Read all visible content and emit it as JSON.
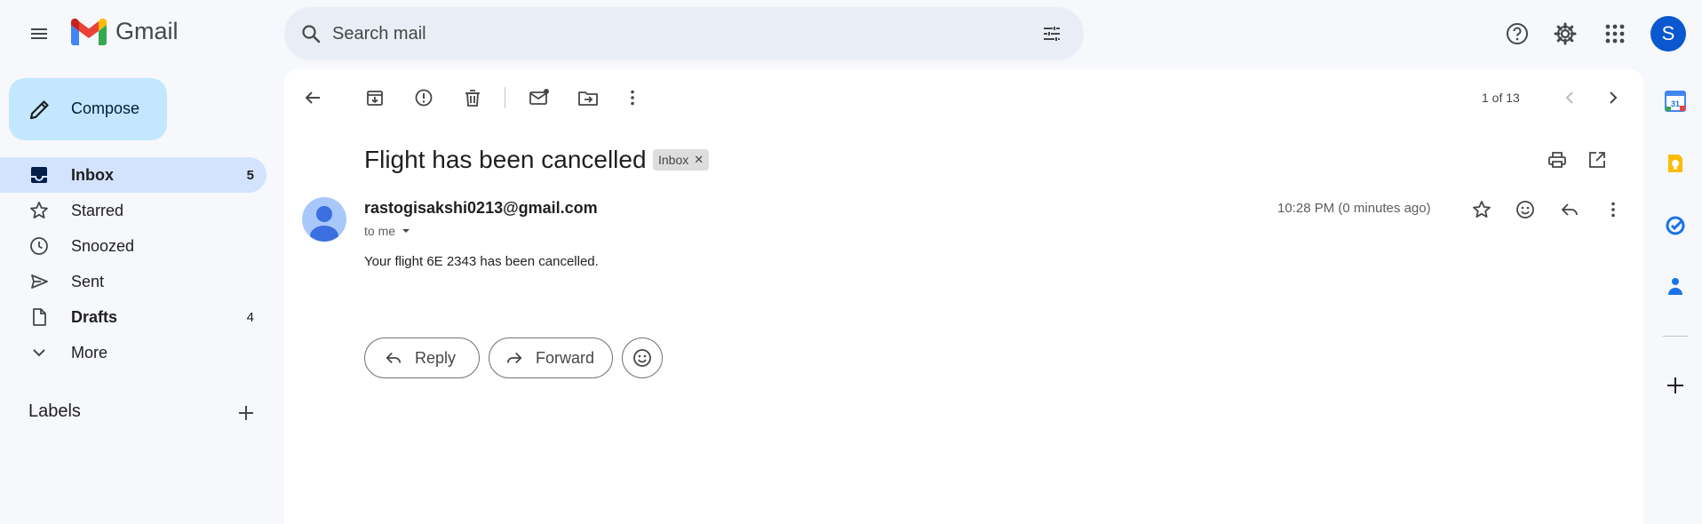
{
  "app": {
    "name": "Gmail"
  },
  "search": {
    "placeholder": "Search mail"
  },
  "user": {
    "avatar_initial": "S"
  },
  "compose": {
    "label": "Compose"
  },
  "sidebar": {
    "items": [
      {
        "label": "Inbox",
        "count": "5",
        "icon": "inbox-icon",
        "active": true
      },
      {
        "label": "Starred",
        "count": "",
        "icon": "star-icon",
        "active": false
      },
      {
        "label": "Snoozed",
        "count": "",
        "icon": "clock-icon",
        "active": false
      },
      {
        "label": "Sent",
        "count": "",
        "icon": "send-icon",
        "active": false
      },
      {
        "label": "Drafts",
        "count": "4",
        "icon": "draft-icon",
        "active": false
      },
      {
        "label": "More",
        "count": "",
        "icon": "chevron-down-icon",
        "active": false
      }
    ],
    "labels_heading": "Labels"
  },
  "toolbar": {
    "pager": "1 of 13"
  },
  "message": {
    "subject": "Flight has been cancelled",
    "label_chip": "Inbox",
    "sender": "rastogisakshi0213@gmail.com",
    "recipient": "to me",
    "timestamp": "10:28 PM (0 minutes ago)",
    "body": "Your flight 6E 2343 has been cancelled."
  },
  "actions": {
    "reply_label": "Reply",
    "forward_label": "Forward"
  },
  "side_apps": {
    "calendar_date": "31",
    "items": [
      "calendar-icon",
      "keep-icon",
      "tasks-icon",
      "contacts-icon",
      "add-icon"
    ]
  },
  "colors": {
    "background": "#f6f8fc",
    "compose": "#c2e7ff",
    "active_nav": "#d3e3fd",
    "accent": "#0b57d0",
    "search": "#e9eef6"
  }
}
